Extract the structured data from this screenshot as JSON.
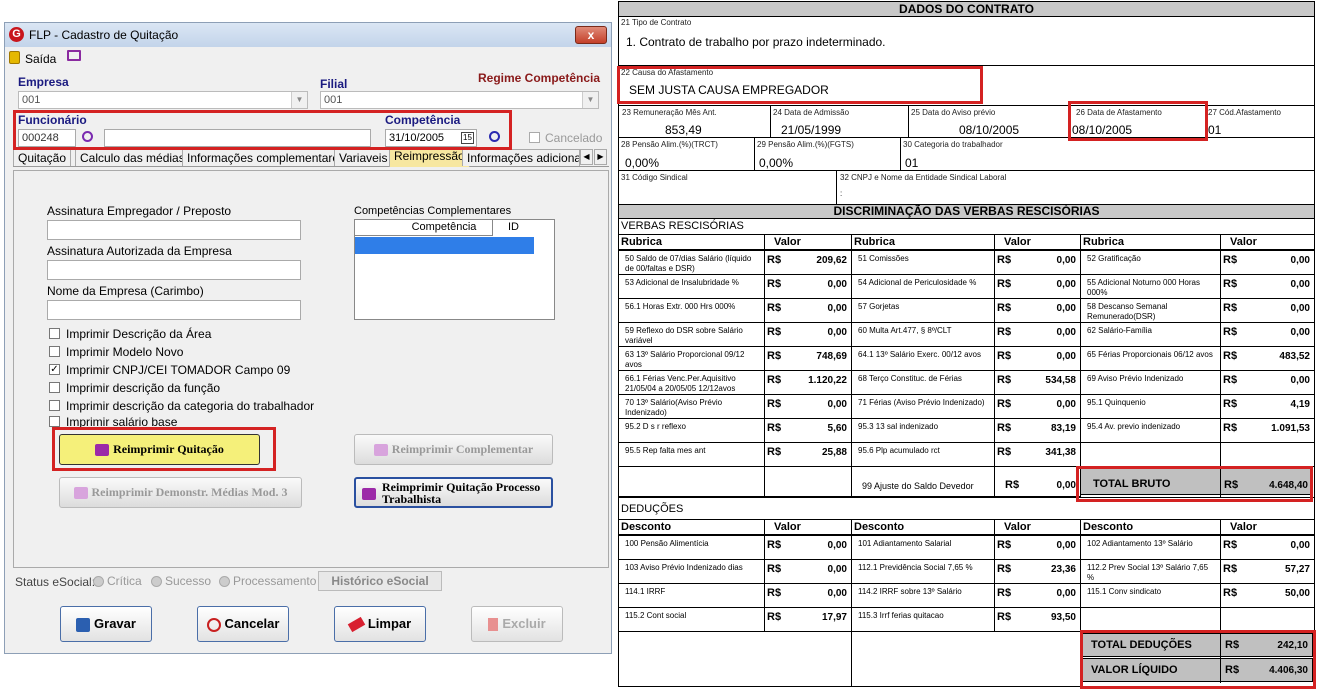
{
  "window": {
    "title": "FLP - Cadastro de Quitação",
    "logo_letter": "G",
    "close_label": "x",
    "menu_exit": "Saída"
  },
  "form": {
    "empresa_label": "Empresa",
    "empresa_value": "001",
    "filial_label": "Filial",
    "filial_value": "001",
    "regime_label": "Regime Competência",
    "funcionario_label": "Funcionário",
    "funcionario_code": "000248",
    "funcionario_name": "",
    "competencia_label": "Competência",
    "competencia_value": "31/10/2005",
    "calendar_day": "15",
    "cancelado_label": "Cancelado"
  },
  "tabs": [
    "Quitação",
    "Calculo das médias",
    "Informações complementares",
    "Variaveis",
    "Reimpressão",
    "Informações adicionais"
  ],
  "panel": {
    "assinatura_empregador_label": "Assinatura Empregador / Preposto",
    "assinatura_autorizada_label": "Assinatura Autorizada da Empresa",
    "nome_empresa_label": "Nome da Empresa (Carimbo)",
    "competencias_label": "Competências Complementares",
    "col_competencia": "Competência",
    "col_id": "ID",
    "checkboxes": [
      {
        "label": "Imprimir Descrição da Área",
        "checked": false
      },
      {
        "label": "Imprimir Modelo Novo",
        "checked": false
      },
      {
        "label": "Imprimir CNPJ/CEI TOMADOR Campo 09",
        "checked": true
      },
      {
        "label": "Imprimir descrição da função",
        "checked": false
      },
      {
        "label": "Imprimir descrição da categoria do trabalhador",
        "checked": false
      },
      {
        "label": "Imprimir salário base",
        "checked": false
      }
    ],
    "btn_reimprimir_quitacao": "Reimprimir Quitação",
    "btn_reimprimir_complementar": "Reimprimir Complementar",
    "btn_reimprimir_demonstr": "Reimprimir Demonstr. Médias Mod. 3",
    "btn_reimprimir_processo": "Reimprimir Quitação Processo Trabalhista"
  },
  "status": {
    "label": "Status eSocial:",
    "critica": "Crítica",
    "sucesso": "Sucesso",
    "processamento": "Processamento",
    "historico": "Histórico eSocial"
  },
  "actions": {
    "gravar": "Gravar",
    "cancelar": "Cancelar",
    "limpar": "Limpar",
    "excluir": "Excluir"
  },
  "doc": {
    "header_contrato": "DADOS DO CONTRATO",
    "f21_cap": "21 Tipo de Contrato",
    "f21_val": "1. Contrato de trabalho por prazo indeterminado.",
    "f22_cap": "22 Causa  do Afastamento",
    "f22_val": "SEM JUSTA CAUSA EMPREGADOR",
    "f23_cap": "23 Remuneração Mês Ant.",
    "f23_val": "853,49",
    "f24_cap": "24 Data de Admissão",
    "f24_val": "21/05/1999",
    "f25_cap": "25 Data do Aviso prévio",
    "f25_val": "08/10/2005",
    "f26_cap": "26 Data  de Afastamento",
    "f26_val": "08/10/2005",
    "f27_cap": "27 Cód.Afastamento",
    "f27_val": "01",
    "f28_cap": "28 Pensão Alim.(%)(TRCT)",
    "f28_val": "0,00%",
    "f29_cap": "29 Pensão Alim.(%)(FGTS)",
    "f29_val": "0,00%",
    "f30_cap": "30 Categoria do trabalhador",
    "f30_val": "01",
    "f31_cap": "31 Código Sindical",
    "f32_cap": "32 CNPJ  e Nome da Entidade Sindical Laboral",
    "f32_val": ":",
    "header_discrim": "DISCRIMINAÇÃO  DAS VERBAS RESCISÓRIAS",
    "verbas_title": "VERBAS RESCISÓRIAS",
    "col_rubrica": "Rubrica",
    "col_valor": "Valor",
    "rs": "R$",
    "verbas": [
      [
        {
          "d": "50 Saldo de 07/dias Salário (líquido de 00/faltas e DSR)",
          "v": "209,62"
        },
        {
          "d": "51 Comissões",
          "v": "0,00"
        },
        {
          "d": "52 Gratificação",
          "v": "0,00"
        }
      ],
      [
        {
          "d": "53 Adicional de Insalubridade        %",
          "v": "0,00"
        },
        {
          "d": "54 Adicional de Periculosidade        %",
          "v": "0,00"
        },
        {
          "d": "55 Adicional Noturno  000 Horas 000%",
          "v": "0,00"
        }
      ],
      [
        {
          "d": "56.1 Horas Extr. 000 Hrs 000%",
          "v": "0,00"
        },
        {
          "d": "57 Gorjetas",
          "v": "0,00"
        },
        {
          "d": "58 Descanso Semanal Remunerado(DSR)",
          "v": "0,00"
        }
      ],
      [
        {
          "d": "59 Reflexo do DSR sobre Salário variável",
          "v": "0,00"
        },
        {
          "d": "60 Multa Art.477, § 8º/CLT",
          "v": "0,00"
        },
        {
          "d": "62 Salário-Família",
          "v": "0,00"
        }
      ],
      [
        {
          "d": " 63 13º Salário Proporcional 09/12 avos",
          "v": "748,69"
        },
        {
          "d": "64.1 13º Salário Exerc.     00/12 avos",
          "v": "0,00"
        },
        {
          "d": "65 Férias Proporcionais  06/12 avos",
          "v": "483,52"
        }
      ],
      [
        {
          "d": "66.1 Férias Venc.Per.Aquisitivo 21/05/04 a 20/05/05 12/12avos",
          "v": "1.120,22"
        },
        {
          "d": "68 Terço Constituc. de Férias",
          "v": "534,58"
        },
        {
          "d": "69 Aviso Prévio Indenizado",
          "v": "0,00"
        }
      ],
      [
        {
          "d": "70 13º Salário(Aviso Prévio Indenizado)",
          "v": "0,00"
        },
        {
          "d": "71 Férias (Aviso Prévio Indenizado)",
          "v": "0,00"
        },
        {
          "d": "95.1 Quinquenio",
          "v": "4,19"
        }
      ],
      [
        {
          "d": "95.2 D s r  reflexo",
          "v": "5,60"
        },
        {
          "d": "95.3 13 sal  indenizado",
          "v": "83,19"
        },
        {
          "d": "95.4 Av. previo indenizado",
          "v": "1.091,53"
        }
      ],
      [
        {
          "d": "95.5 Rep  falta mes ant",
          "v": "25,88"
        },
        {
          "d": "95.6 Plp acumulado rct",
          "v": "341,38"
        },
        {
          "d": "",
          "v": ""
        }
      ]
    ],
    "ajuste_label": "99  Ajuste do Saldo Devedor",
    "ajuste_val": "0,00",
    "total_bruto_label": "TOTAL BRUTO",
    "total_bruto_val": "4.648,40",
    "deducoes_title": "DEDUÇÕES",
    "col_desconto": "Desconto",
    "deducoes": [
      [
        {
          "d": "100 Pensão Alimentícia",
          "v": "0,00"
        },
        {
          "d": "101 Adiantamento Salarial",
          "v": "0,00"
        },
        {
          "d": "102 Adiantamento 13º Salário",
          "v": "0,00"
        }
      ],
      [
        {
          "d": "103 Aviso  Prévio Indenizado      dias",
          "v": "0,00"
        },
        {
          "d": "112.1 Previdência Social 7,65 %",
          "v": "23,36"
        },
        {
          "d": "112.2 Prev Social 13º Salário 7,65 %",
          "v": "57,27"
        }
      ],
      [
        {
          "d": "114.1 IRRF",
          "v": "0,00"
        },
        {
          "d": "114.2 IRRF sobre 13º Salário",
          "v": "0,00"
        },
        {
          "d": "115.1 Conv sindicato",
          "v": "50,00"
        }
      ],
      [
        {
          "d": "115.2 Cont social",
          "v": "17,97"
        },
        {
          "d": "115.3 Irrf ferias quitacao",
          "v": "93,50"
        },
        {
          "d": "",
          "v": ""
        }
      ]
    ],
    "total_deducoes_label": "TOTAL  DEDUÇÕES",
    "total_deducoes_val": "242,10",
    "valor_liquido_label": "VALOR LÍQUIDO",
    "valor_liquido_val": "4.406,30"
  }
}
